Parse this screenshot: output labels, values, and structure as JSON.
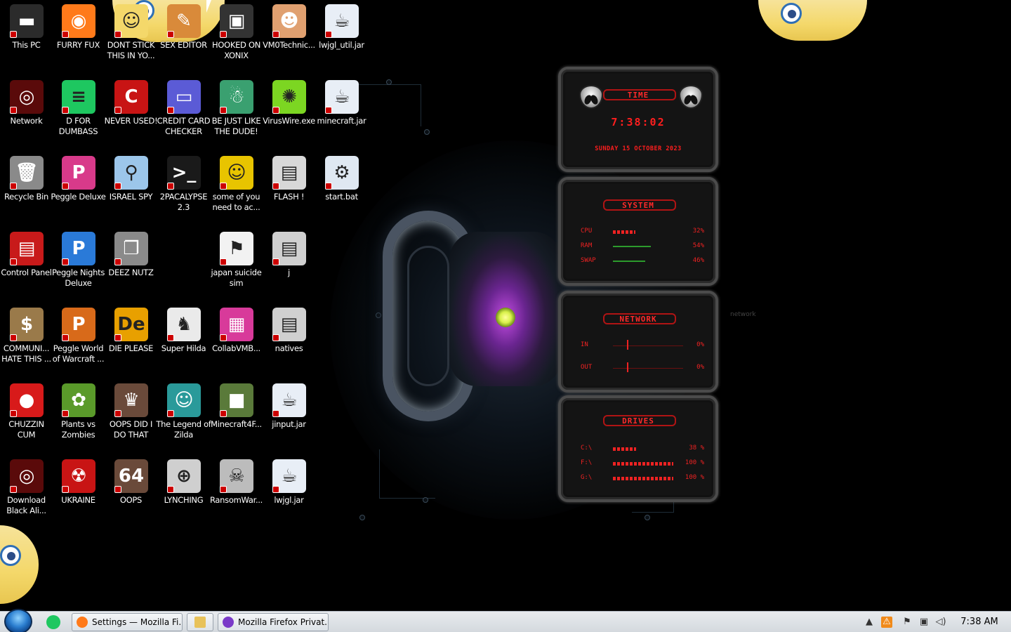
{
  "desktop": {
    "icons": [
      {
        "label": "This PC",
        "icon": "computer-icon",
        "color": "#2b2b2b",
        "glyph": "▬"
      },
      {
        "label": "FURRY FUX",
        "icon": "firefox-icon",
        "color": "#ff7a1a",
        "glyph": "◉"
      },
      {
        "label": "DONT STICK THIS IN YO...",
        "icon": "cartoon-icon",
        "color": "#f4d86a",
        "glyph": "☺"
      },
      {
        "label": "SEX EDITOR",
        "icon": "cartoon-icon",
        "color": "#d98a3a",
        "glyph": "✎"
      },
      {
        "label": "HOOKED ON XONIX",
        "icon": "game-icon",
        "color": "#333333",
        "glyph": "▣"
      },
      {
        "label": "VM0Technic...",
        "icon": "doctor-icon",
        "color": "#e0a070",
        "glyph": "☻"
      },
      {
        "label": "lwjgl_util.jar",
        "icon": "java-icon",
        "color": "#e8eef6",
        "glyph": "☕"
      },
      {
        "label": "Network",
        "icon": "network-icon",
        "color": "#5a0a0a",
        "glyph": "◎"
      },
      {
        "label": "D FOR DUMBASS",
        "icon": "spotify-icon",
        "color": "#1ec760",
        "glyph": "≡"
      },
      {
        "label": "NEVER USED!",
        "icon": "devcpp-icon",
        "color": "#c81414",
        "glyph": "C"
      },
      {
        "label": "CREDIT CARD CHECKER",
        "icon": "credit-card-icon",
        "color": "#5b5bd6",
        "glyph": "▭"
      },
      {
        "label": "BE JUST LIKE THE DUDE!",
        "icon": "santa-icon",
        "color": "#3aa070",
        "glyph": "☃"
      },
      {
        "label": "VirusWire.exe",
        "icon": "lime-icon",
        "color": "#7cd622",
        "glyph": "✺"
      },
      {
        "label": "minecraft.jar",
        "icon": "java-icon",
        "color": "#e8eef6",
        "glyph": "☕"
      },
      {
        "label": "Recycle Bin",
        "icon": "recycle-bin-icon",
        "color": "#8a8a8a",
        "glyph": "🗑"
      },
      {
        "label": "Peggle Deluxe",
        "icon": "peggle-icon",
        "color": "#d83a8a",
        "glyph": "P"
      },
      {
        "label": "ISRAEL SPY",
        "icon": "spy-icon",
        "color": "#9cc6ea",
        "glyph": "⚲"
      },
      {
        "label": "2PACALYPSE 2.3",
        "icon": "terminal-icon",
        "color": "#1a1a1a",
        "glyph": ">_"
      },
      {
        "label": "some of you need to ac...",
        "icon": "beaver-icon",
        "color": "#e8c400",
        "glyph": "☺"
      },
      {
        "label": "FLASH !",
        "icon": "book-icon",
        "color": "#d8d8d8",
        "glyph": "▤"
      },
      {
        "label": "start.bat",
        "icon": "batch-gear-icon",
        "color": "#dfe8f2",
        "glyph": "⚙"
      },
      {
        "label": "Control Panel",
        "icon": "control-panel-icon",
        "color": "#c81a1a",
        "glyph": "▤"
      },
      {
        "label": "Peggle Nights Deluxe",
        "icon": "peggle-icon",
        "color": "#2a7ad8",
        "glyph": "P"
      },
      {
        "label": "DEEZ NUTZ",
        "icon": "stack-icon",
        "color": "#8a8a8a",
        "glyph": "❐"
      },
      {
        "label": "",
        "icon": "",
        "color": "",
        "glyph": ""
      },
      {
        "label": "japan suicide sim",
        "icon": "sim-icon",
        "color": "#f2f2f2",
        "glyph": "⚑"
      },
      {
        "label": "j",
        "icon": "book-icon",
        "color": "#d0d0d0",
        "glyph": "▤"
      },
      {
        "label": "",
        "icon": "",
        "color": "",
        "glyph": ""
      },
      {
        "label": "COMMUNI... HATE THIS ...",
        "icon": "money-bag-icon",
        "color": "#9a7a4a",
        "glyph": "$"
      },
      {
        "label": "Peggle World of Warcraft ...",
        "icon": "peggle-icon",
        "color": "#d86a1a",
        "glyph": "P"
      },
      {
        "label": "DIE PLEASE",
        "icon": "dreamweaver-icon",
        "color": "#e8a000",
        "glyph": "De"
      },
      {
        "label": "Super Hilda",
        "icon": "pixel-cat-icon",
        "color": "#eaeaea",
        "glyph": "♞"
      },
      {
        "label": "CollabVMB...",
        "icon": "monitor-icon",
        "color": "#d83a9a",
        "glyph": "▦"
      },
      {
        "label": "natives",
        "icon": "book-icon",
        "color": "#d0d0d0",
        "glyph": "▤"
      },
      {
        "label": "",
        "icon": "",
        "color": "",
        "glyph": ""
      },
      {
        "label": "CHUZZIN CUM",
        "icon": "chuzzle-icon",
        "color": "#d81a1a",
        "glyph": "●"
      },
      {
        "label": "Plants vs Zombies",
        "icon": "plant-icon",
        "color": "#5a9a2a",
        "glyph": "✿"
      },
      {
        "label": "OOPS DID I DO THAT",
        "icon": "portrait-icon",
        "color": "#6a4a3a",
        "glyph": "♛"
      },
      {
        "label": "The Legend of Zilda",
        "icon": "pixel-character-icon",
        "color": "#2a9a9a",
        "glyph": "☺"
      },
      {
        "label": "Minecraft4F...",
        "icon": "grass-block-icon",
        "color": "#5a7a3a",
        "glyph": "■"
      },
      {
        "label": "jinput.jar",
        "icon": "java-icon",
        "color": "#e8eef6",
        "glyph": "☕"
      },
      {
        "label": "",
        "icon": "",
        "color": "",
        "glyph": ""
      },
      {
        "label": "Download Black Ali...",
        "icon": "alienware-icon",
        "color": "#5a0a0a",
        "glyph": "◎"
      },
      {
        "label": "UKRAINE",
        "icon": "radiation-icon",
        "color": "#c81414",
        "glyph": "☢"
      },
      {
        "label": "OOPS",
        "icon": "portrait-icon",
        "color": "#6a4a3a",
        "glyph": "64"
      },
      {
        "label": "LYNCHING",
        "icon": "rope-icon",
        "color": "#cfcfcf",
        "glyph": "⊕"
      },
      {
        "label": "RansomWar...",
        "icon": "skull-icon",
        "color": "#bcbcbc",
        "glyph": "☠"
      },
      {
        "label": "lwjgl.jar",
        "icon": "java-icon",
        "color": "#e8eef6",
        "glyph": "☕"
      },
      {
        "label": "",
        "icon": "",
        "color": "",
        "glyph": ""
      }
    ]
  },
  "gadget": {
    "time": {
      "title": "TIME",
      "clock": "7:38:02",
      "date": "SUNDAY 15 OCTOBER 2023"
    },
    "system": {
      "title": "SYSTEM",
      "rows": [
        {
          "label": "CPU",
          "value": "32%",
          "level": 0.32
        },
        {
          "label": "RAM",
          "value": "54%",
          "level": 0.54
        },
        {
          "label": "SWAP",
          "value": "46%",
          "level": 0.46
        }
      ]
    },
    "network": {
      "title": "NETWORK",
      "rows": [
        {
          "label": "IN",
          "value": "0%"
        },
        {
          "label": "OUT",
          "value": "0%"
        }
      ]
    },
    "drives": {
      "title": "DRIVES",
      "rows": [
        {
          "label": "C:\\",
          "value": "38 %",
          "level": 0.38
        },
        {
          "label": "F:\\",
          "value": "100 %",
          "level": 1.0
        },
        {
          "label": "G:\\",
          "value": "100 %",
          "level": 1.0
        }
      ]
    },
    "side_label": "network"
  },
  "taskbar": {
    "start_label": "Start",
    "quick_launch": [
      {
        "icon": "spotify-icon",
        "color": "#1ec760"
      }
    ],
    "windows": [
      {
        "label": "Settings — Mozilla Fi...",
        "icon": "firefox-icon",
        "color": "#ff7a1a"
      },
      {
        "label": "",
        "icon": "file-explorer-icon",
        "color": "#e8c25a"
      },
      {
        "label": "Mozilla Firefox Privat...",
        "icon": "firefox-private-icon",
        "color": "#7a3ac8"
      }
    ],
    "tray": [
      {
        "icon": "show-hidden-icons-icon",
        "glyph": "▲"
      },
      {
        "icon": "tray-app-icon",
        "glyph": "⚠"
      },
      {
        "icon": "action-center-icon",
        "glyph": "⚑"
      },
      {
        "icon": "network-tray-icon",
        "glyph": "▣"
      },
      {
        "icon": "volume-icon",
        "glyph": "◁)"
      }
    ],
    "clock": "7:38 AM"
  }
}
